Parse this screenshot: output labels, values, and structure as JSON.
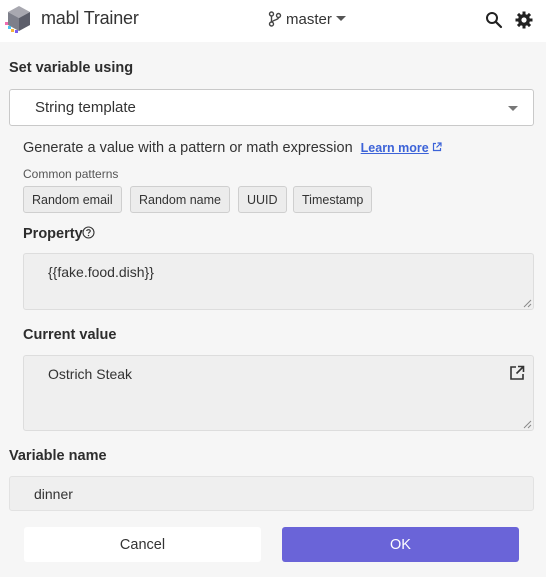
{
  "header": {
    "app_title": "mabl Trainer",
    "branch": "master",
    "icons": [
      "mabl-logo-icon",
      "branch-icon",
      "chevron-down-icon",
      "search-icon",
      "gear-icon"
    ]
  },
  "form": {
    "set_variable_label": "Set variable using",
    "method_select_value": "String template",
    "description": "Generate a value with a pattern or math expression",
    "learn_more": "Learn more",
    "common_patterns_label": "Common patterns",
    "patterns": [
      "Random email",
      "Random name",
      "UUID",
      "Timestamp"
    ],
    "property_label": "Property",
    "property_value": "{{fake.food.dish}}",
    "current_value_label": "Current value",
    "current_value": "Ostrich Steak",
    "variable_name_label": "Variable name",
    "variable_name_value": "dinner"
  },
  "actions": {
    "cancel": "Cancel",
    "ok": "OK"
  },
  "colors": {
    "accent": "#6a64d8",
    "link": "#3c63d8",
    "background": "#f6f6f6"
  }
}
